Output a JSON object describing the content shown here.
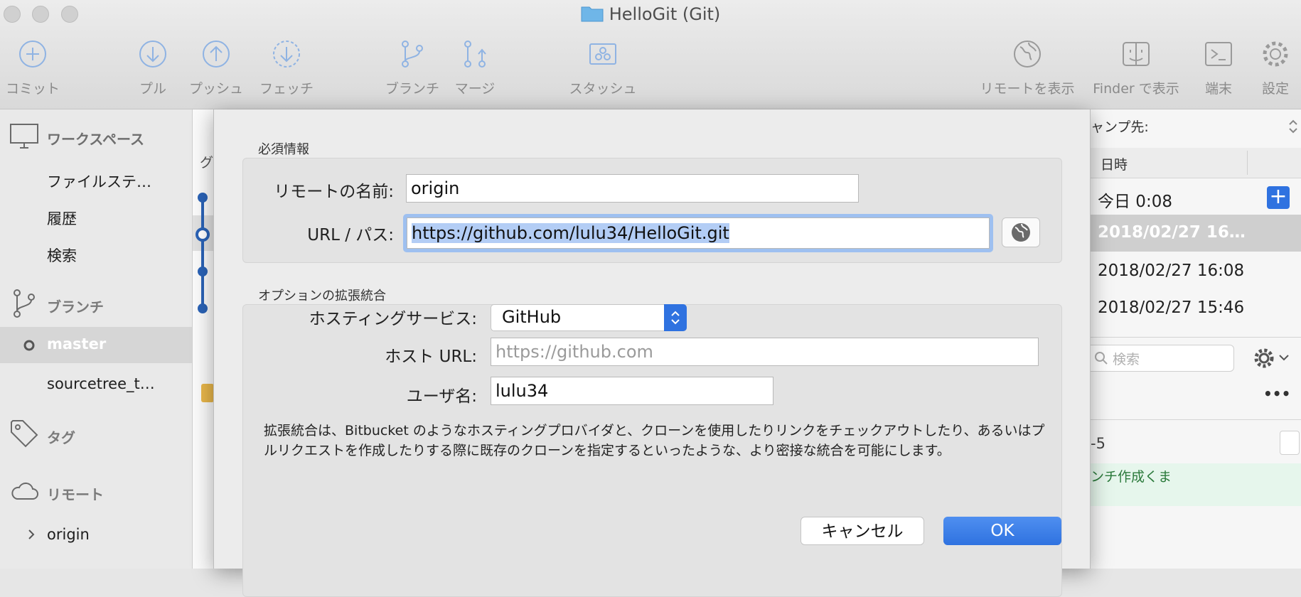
{
  "window": {
    "title": "HelloGit (Git)"
  },
  "toolbar": {
    "commit": "コミット",
    "pull": "プル",
    "push": "プッシュ",
    "fetch": "フェッチ",
    "branch": "ブランチ",
    "merge": "マージ",
    "stash": "スタッシュ",
    "show_remote": "リモートを表示",
    "show_in_finder": "Finder で表示",
    "terminal": "端末",
    "settings": "設定"
  },
  "sidebar": {
    "workspace": "ワークスペース",
    "file_status": "ファイルステ…",
    "history": "履歴",
    "search": "検索",
    "branches": "ブランチ",
    "master": "master",
    "sourcetree_branch": "sourcetree_t…",
    "tags": "タグ",
    "remotes": "リモート",
    "origin": "origin"
  },
  "center": {
    "column_partial": "グ"
  },
  "right": {
    "jump_label": "ャンプ先:",
    "date_header": "日時",
    "dates": [
      "今日 0:08",
      "2018/02/27 16…",
      "2018/02/27 16:08",
      "2018/02/27 15:46"
    ],
    "search_placeholder": "検索",
    "more": "•••",
    "partial_text": "-5",
    "commit_msg_partial": "ンチ作成くま"
  },
  "dialog": {
    "required_section": "必須情報",
    "remote_name_label": "リモートの名前:",
    "remote_name_value": "origin",
    "url_label": "URL / パス:",
    "url_value": "https://github.com/lulu34/HelloGit.git",
    "optional_section": "オプションの拡張統合",
    "hosting_label": "ホスティングサービス:",
    "hosting_value": "GitHub",
    "host_url_label": "ホスト URL:",
    "host_url_placeholder": "https://github.com",
    "username_label": "ユーザ名:",
    "username_value": "lulu34",
    "description": "拡張統合は、Bitbucket のようなホスティングプロバイダと、クローンを使用したりリンクをチェックアウトしたり、あるいはプルリクエストを作成したりする際に既存のクローンを指定するといったような、より密接な統合を可能にします。",
    "cancel": "キャンセル",
    "ok": "OK"
  },
  "colors": {
    "accent": "#2f72e0",
    "graph": "#2a62b5",
    "selection": "#b3cdf5"
  }
}
